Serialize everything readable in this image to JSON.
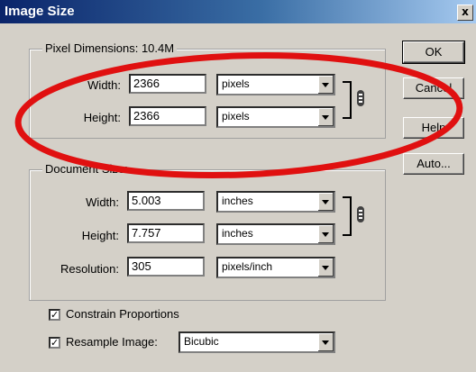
{
  "window": {
    "title": "Image Size",
    "close_glyph": "x"
  },
  "pixel_dimensions": {
    "legend": "Pixel Dimensions:",
    "size": "10.4M",
    "width": {
      "label": "Width:",
      "value": "2366",
      "unit": "pixels"
    },
    "height": {
      "label": "Height:",
      "value": "2366",
      "unit": "pixels"
    }
  },
  "document_size": {
    "legend": "Document Size:",
    "width": {
      "label": "Width:",
      "value": "5.003",
      "unit": "inches"
    },
    "height": {
      "label": "Height:",
      "value": "7.757",
      "unit": "inches"
    },
    "resolution": {
      "label": "Resolution:",
      "value": "305",
      "unit": "pixels/inch"
    }
  },
  "buttons": {
    "ok": "OK",
    "cancel": "Cancel",
    "help": "Help",
    "auto": "Auto..."
  },
  "options": {
    "constrain": {
      "label": "Constrain Proportions",
      "checked": true
    },
    "resample": {
      "label": "Resample Image:",
      "checked": true,
      "method": "Bicubic"
    }
  },
  "icons": {
    "link": "chain-link-icon",
    "close": "close-icon",
    "dropdown": "chevron-down-icon",
    "check": "checkmark-icon"
  },
  "colors": {
    "annotation_ellipse": "#e01010",
    "titlebar": "#0a246a",
    "dialog_bg": "#d4d0c8"
  }
}
